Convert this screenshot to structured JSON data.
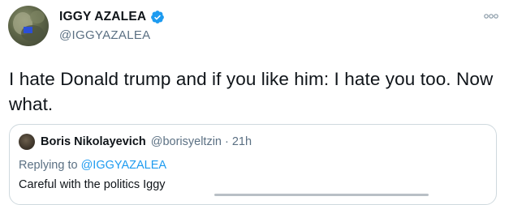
{
  "tweet": {
    "author": {
      "display_name": "IGGY AZALEA",
      "handle": "@IGGYAZALEA",
      "avatar_icon": "user-avatar-icon",
      "verified_icon": "verified-badge-icon"
    },
    "more_icon": "more-options-icon",
    "text": "I hate Donald trump and if you like him: I hate you too. Now what.",
    "quoted": {
      "display_name": "Boris Nikolayevich",
      "handle": "@borisyeltzin",
      "separator": "·",
      "time": "21h",
      "replying_prefix": "Replying to",
      "replying_to": "@IGGYAZALEA",
      "text": "Careful with the politics Iggy"
    }
  },
  "colors": {
    "accent": "#1d9bf0",
    "secondary_text": "#5b7083",
    "border": "#cfd9de"
  }
}
